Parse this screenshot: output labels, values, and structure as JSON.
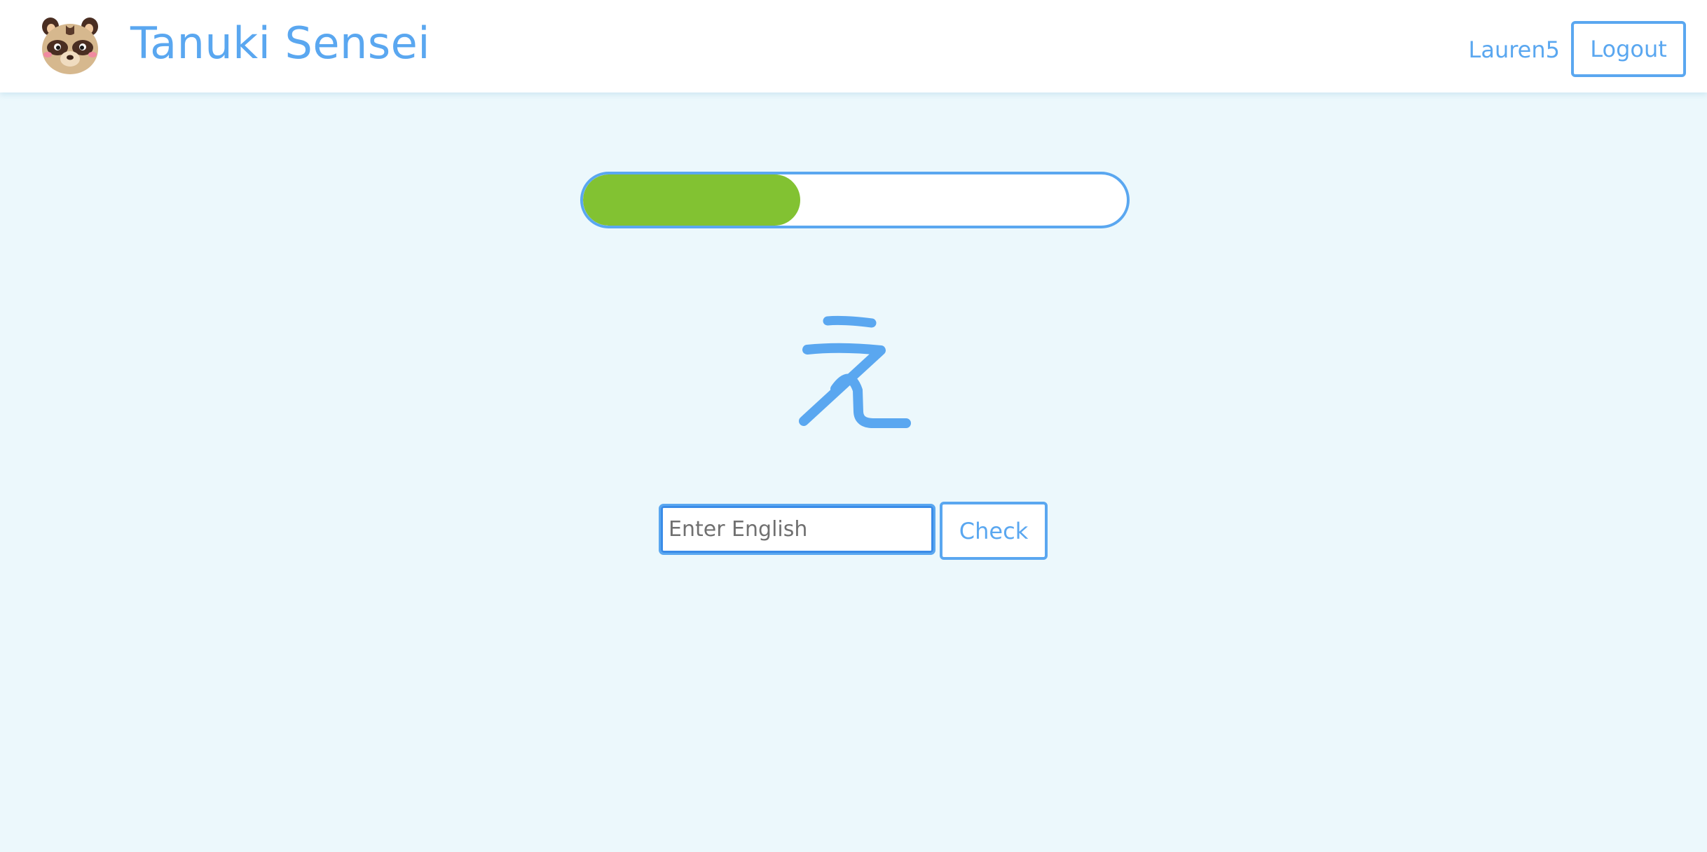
{
  "header": {
    "app_title": "Tanuki Sensei",
    "logo_icon": "tanuki-face-icon",
    "username": "Lauren5",
    "logout_label": "Logout"
  },
  "quiz": {
    "progress": 0.4,
    "character": "え",
    "answer_placeholder": "Enter English",
    "answer_value": "",
    "check_label": "Check"
  },
  "colors": {
    "accent": "#5aa7f0",
    "progress_fill": "#82c232",
    "page_background": "#ecf8fc",
    "header_background": "#ffffff"
  }
}
